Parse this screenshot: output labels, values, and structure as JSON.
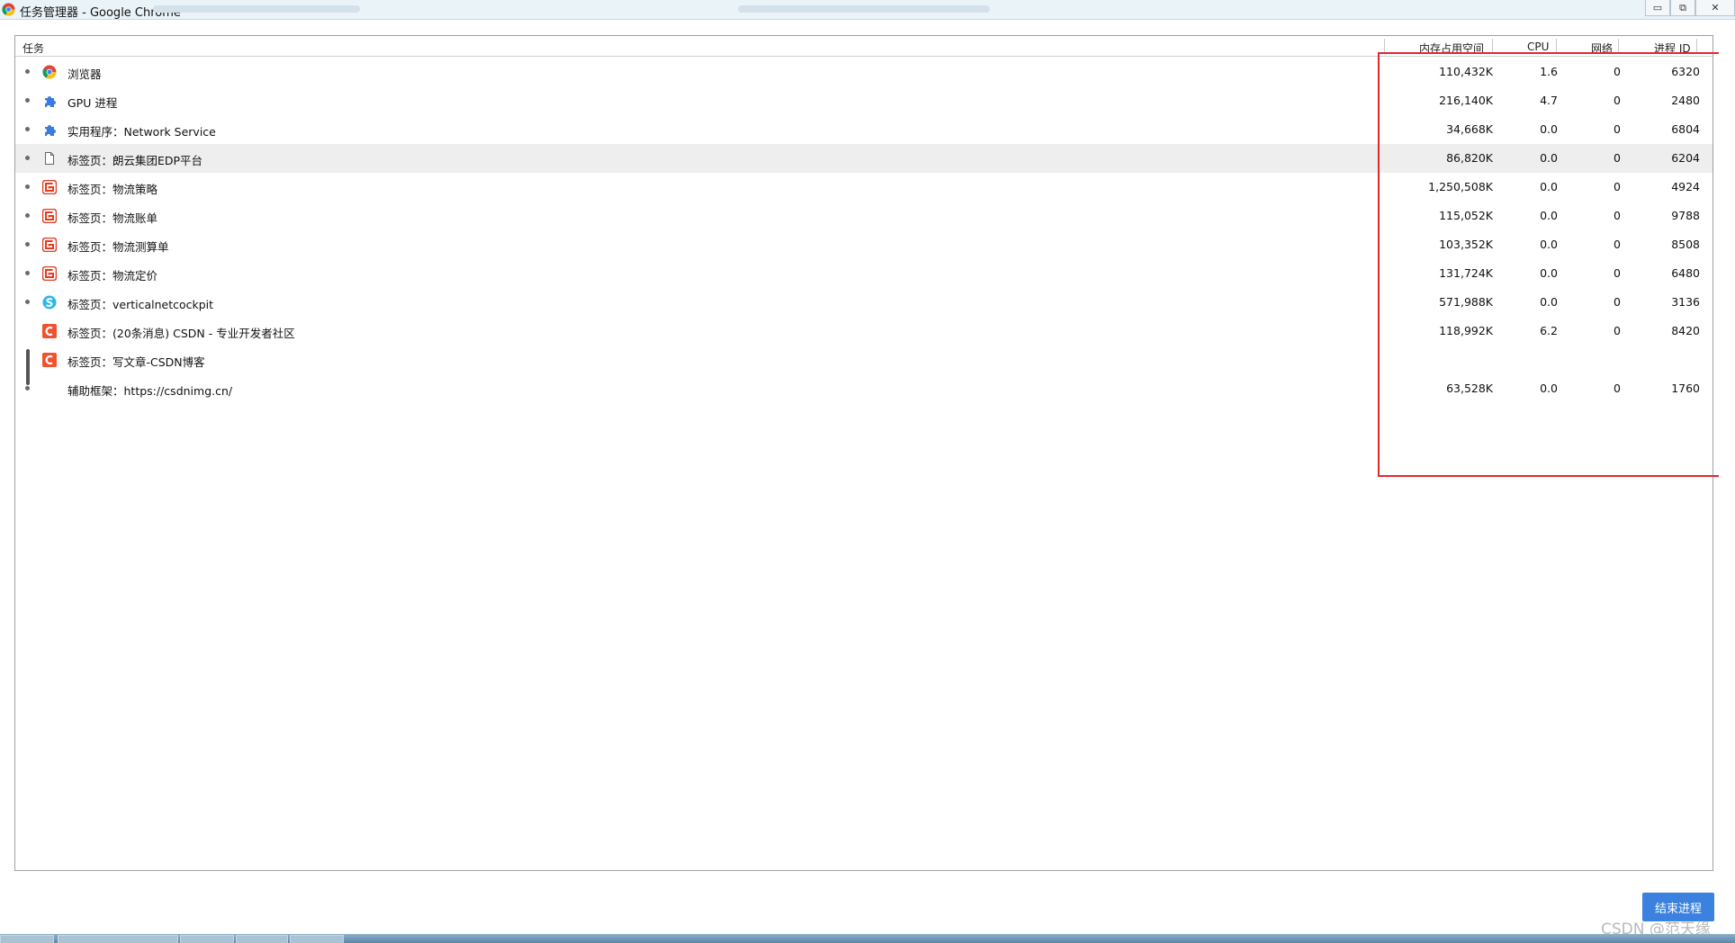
{
  "window": {
    "title": "任务管理器 - Google Chrome",
    "minimize_glyph": "▭",
    "restore_glyph": "⧉",
    "close_glyph": "✕"
  },
  "table": {
    "columns": {
      "task": "任务",
      "memory": "内存占用空间",
      "cpu": "CPU",
      "network": "网络",
      "pid": "进程 ID"
    },
    "rows": [
      {
        "icon": "chrome-icon",
        "name": "浏览器",
        "memory": "110,432K",
        "cpu": "1.6",
        "network": "0",
        "pid": "6320"
      },
      {
        "icon": "puzzle-piece-icon",
        "name": "GPU 进程",
        "memory": "216,140K",
        "cpu": "4.7",
        "network": "0",
        "pid": "2480"
      },
      {
        "icon": "puzzle-piece-icon",
        "name": "实用程序：Network Service",
        "memory": "34,668K",
        "cpu": "0.0",
        "network": "0",
        "pid": "6804"
      },
      {
        "icon": "blank-page-icon",
        "name": "标签页：朗云集团EDP平台",
        "memory": "86,820K",
        "cpu": "0.0",
        "network": "0",
        "pid": "6204"
      },
      {
        "icon": "red-spiral-logo-icon",
        "name": "标签页：物流策略",
        "memory": "1,250,508K",
        "cpu": "0.0",
        "network": "0",
        "pid": "4924"
      },
      {
        "icon": "red-spiral-logo-icon",
        "name": "标签页：物流账单",
        "memory": "115,052K",
        "cpu": "0.0",
        "network": "0",
        "pid": "9788"
      },
      {
        "icon": "red-spiral-logo-icon",
        "name": "标签页：物流测算单",
        "memory": "103,352K",
        "cpu": "0.0",
        "network": "0",
        "pid": "8508"
      },
      {
        "icon": "red-spiral-logo-icon",
        "name": "标签页：物流定价",
        "memory": "131,724K",
        "cpu": "0.0",
        "network": "0",
        "pid": "6480"
      },
      {
        "icon": "cyan-s-logo-icon",
        "name": "标签页：verticalnetcockpit",
        "memory": "571,988K",
        "cpu": "0.0",
        "network": "0",
        "pid": "3136"
      },
      {
        "icon": "csdn-c-logo-icon",
        "name": "标签页：(20条消息) CSDN - 专业开发者社区",
        "memory": "118,992K",
        "cpu": "6.2",
        "network": "0",
        "pid": "8420"
      },
      {
        "icon": "csdn-c-logo-icon",
        "name": "标签页：写文章-CSDN博客",
        "memory": "",
        "cpu": "",
        "network": "",
        "pid": ""
      },
      {
        "icon": "",
        "name": "辅助框架：https://csdnimg.cn/",
        "memory": "63,528K",
        "cpu": "0.0",
        "network": "0",
        "pid": "1760"
      }
    ]
  },
  "end_process_label": "结束进程",
  "watermark": "CSDN @范天缘",
  "colors": {
    "highlight_box": "#e0282f",
    "button_blue": "#3b82e0",
    "selected_row": "#eeeeee"
  }
}
